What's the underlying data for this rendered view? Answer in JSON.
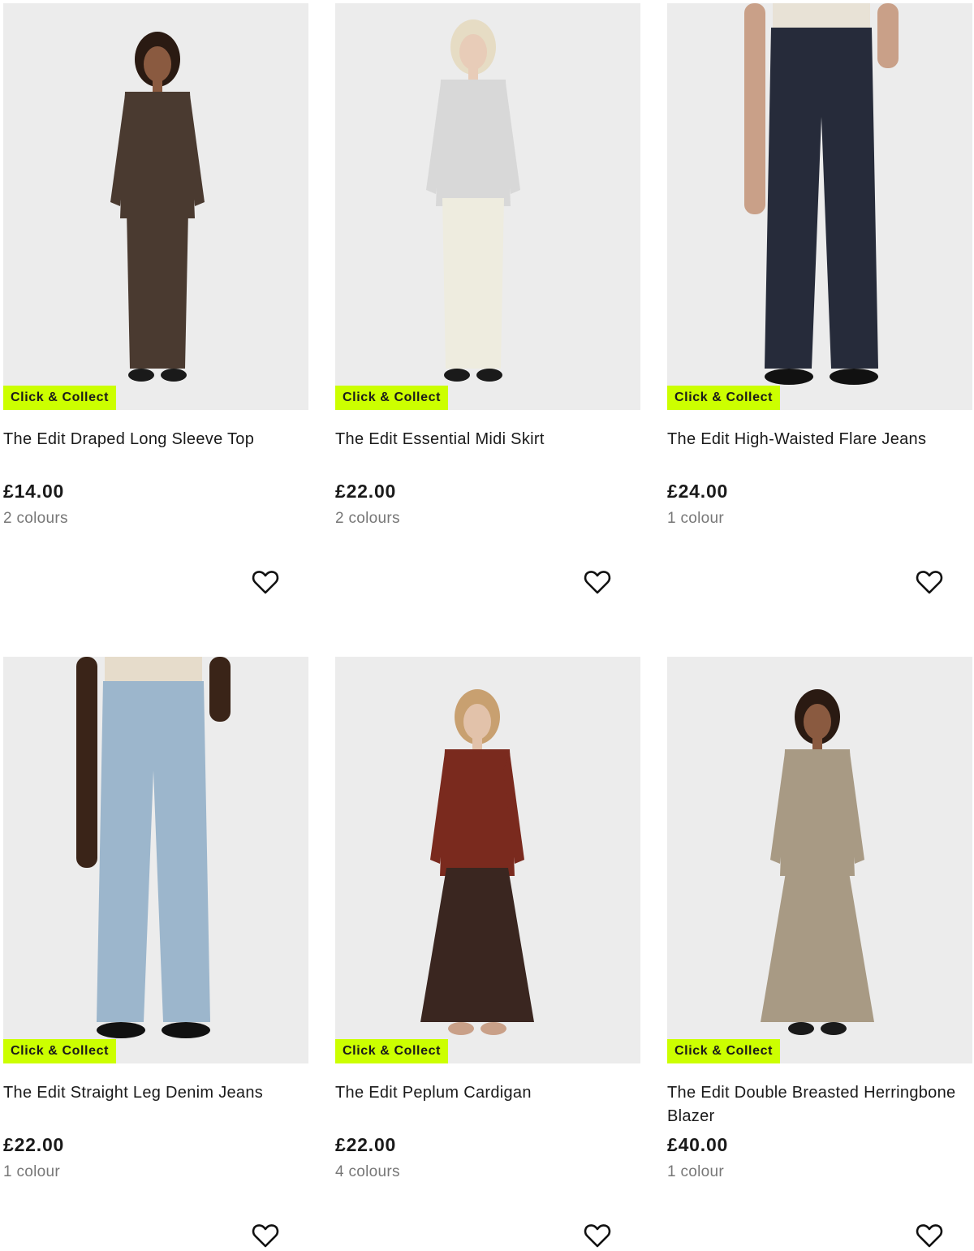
{
  "products": [
    {
      "badge": "Click & Collect",
      "title": "The Edit Draped Long Sleeve Top",
      "price": "£14.00",
      "colours": "2 colours",
      "colors": {
        "top": "#4a3a30",
        "bottom": "#4a3a30",
        "shoes": "#1a1a1a",
        "skin": "#8a5a40",
        "hair": "#2a1a12"
      }
    },
    {
      "badge": "Click & Collect",
      "title": "The Edit Essential Midi Skirt",
      "price": "£22.00",
      "colours": "2 colours",
      "colors": {
        "top": "#d8d8d8",
        "bottom": "#eeecdf",
        "shoes": "#1a1a1a",
        "skin": "#e8ccb8",
        "hair": "#e6dcc4"
      }
    },
    {
      "badge": "Click & Collect",
      "title": "The Edit High-Waisted Flare Jeans",
      "price": "£24.00",
      "colours": "1 colour",
      "colors": {
        "top": "#e8e2d6",
        "bottom": "#262b3a",
        "shoes": "#111111",
        "skin": "#c9a088",
        "hair": "#000000"
      }
    },
    {
      "badge": "Click & Collect",
      "title": "The Edit Straight Leg Denim Jeans",
      "price": "£22.00",
      "colours": "1 colour",
      "colors": {
        "top": "#e6dccb",
        "bottom": "#9cb6cc",
        "shoes": "#111111",
        "skin": "#3a2418",
        "hair": "#000000"
      }
    },
    {
      "badge": "Click & Collect",
      "title": "The Edit Peplum Cardigan",
      "price": "£22.00",
      "colours": "4 colours",
      "colors": {
        "top": "#7a2a1e",
        "bottom": "#3a2620",
        "shoes": "#c9a088",
        "skin": "#e2c2aa",
        "hair": "#c8a070"
      }
    },
    {
      "badge": "Click & Collect",
      "title": "The Edit Double Breasted Herringbone Blazer",
      "price": "£40.00",
      "colours": "1 colour",
      "colors": {
        "top": "#a89a84",
        "bottom": "#a89a84",
        "shoes": "#1a1a1a",
        "skin": "#8a5a40",
        "hair": "#2a1a12"
      }
    }
  ],
  "wishlist_icon": "heart-outline-icon",
  "badge_color": "#ccff00"
}
